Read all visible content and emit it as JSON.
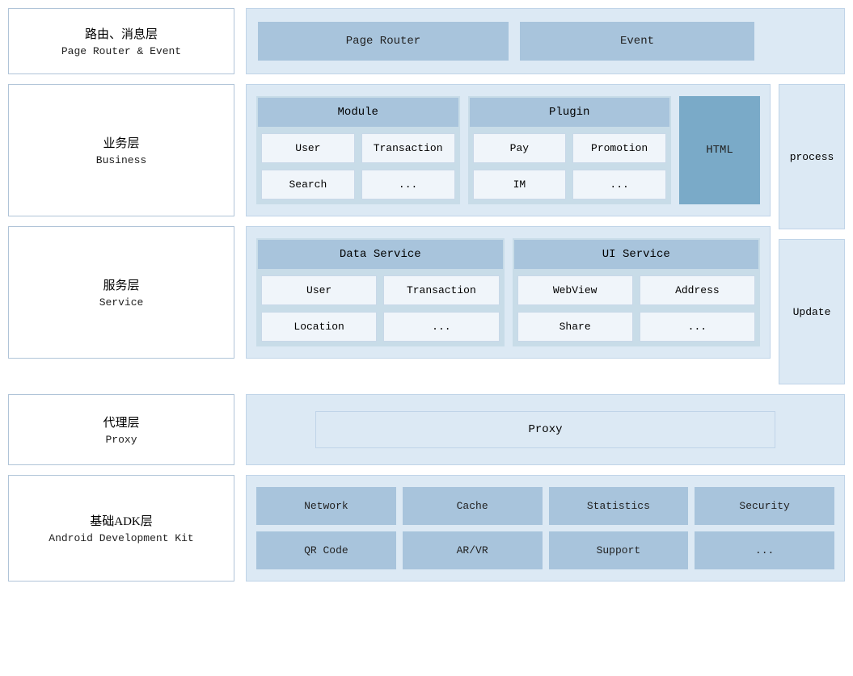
{
  "rows": [
    {
      "id": "row1",
      "left": {
        "chinese": "路由、消息层",
        "english": "Page Router & Event"
      },
      "blocks": [
        {
          "id": "page-router",
          "label": "Page Router"
        },
        {
          "id": "event",
          "label": "Event"
        }
      ]
    },
    {
      "id": "row2",
      "left": {
        "chinese": "业务层",
        "english": "Business"
      },
      "module": {
        "header": "Module",
        "cells": [
          "User",
          "Transaction",
          "Search",
          "..."
        ]
      },
      "plugin": {
        "header": "Plugin",
        "cells": [
          "Pay",
          "Promotion",
          "IM",
          "..."
        ]
      },
      "html": "HTML"
    },
    {
      "id": "row3",
      "left": {
        "chinese": "服务层",
        "english": "Service"
      },
      "dataService": {
        "header": "Data Service",
        "cells": [
          "User",
          "Transaction",
          "Location",
          "..."
        ]
      },
      "uiService": {
        "header": "UI Service",
        "cells": [
          "WebView",
          "Address",
          "Share",
          "..."
        ]
      }
    },
    {
      "id": "row4",
      "left": {
        "chinese": "代理层",
        "english": "Proxy"
      },
      "proxy": "Proxy"
    },
    {
      "id": "row5",
      "left": {
        "chinese": "基础ADK层",
        "english": "Android Development Kit"
      },
      "adk": {
        "row1": [
          "Network",
          "Cache",
          "Statistics",
          "Security"
        ],
        "row2": [
          "QR Code",
          "AR/VR",
          "Support",
          "..."
        ]
      }
    }
  ],
  "sideBlocks": {
    "process": "process",
    "update": "Update"
  },
  "colors": {
    "leftBorder": "#b0c4d8",
    "bgLight": "#dce9f4",
    "bgMedium": "#a8c4dc",
    "bgDark": "#7aaac8",
    "cellBg": "#f0f5fa",
    "borderColor": "#c0d4e8"
  }
}
